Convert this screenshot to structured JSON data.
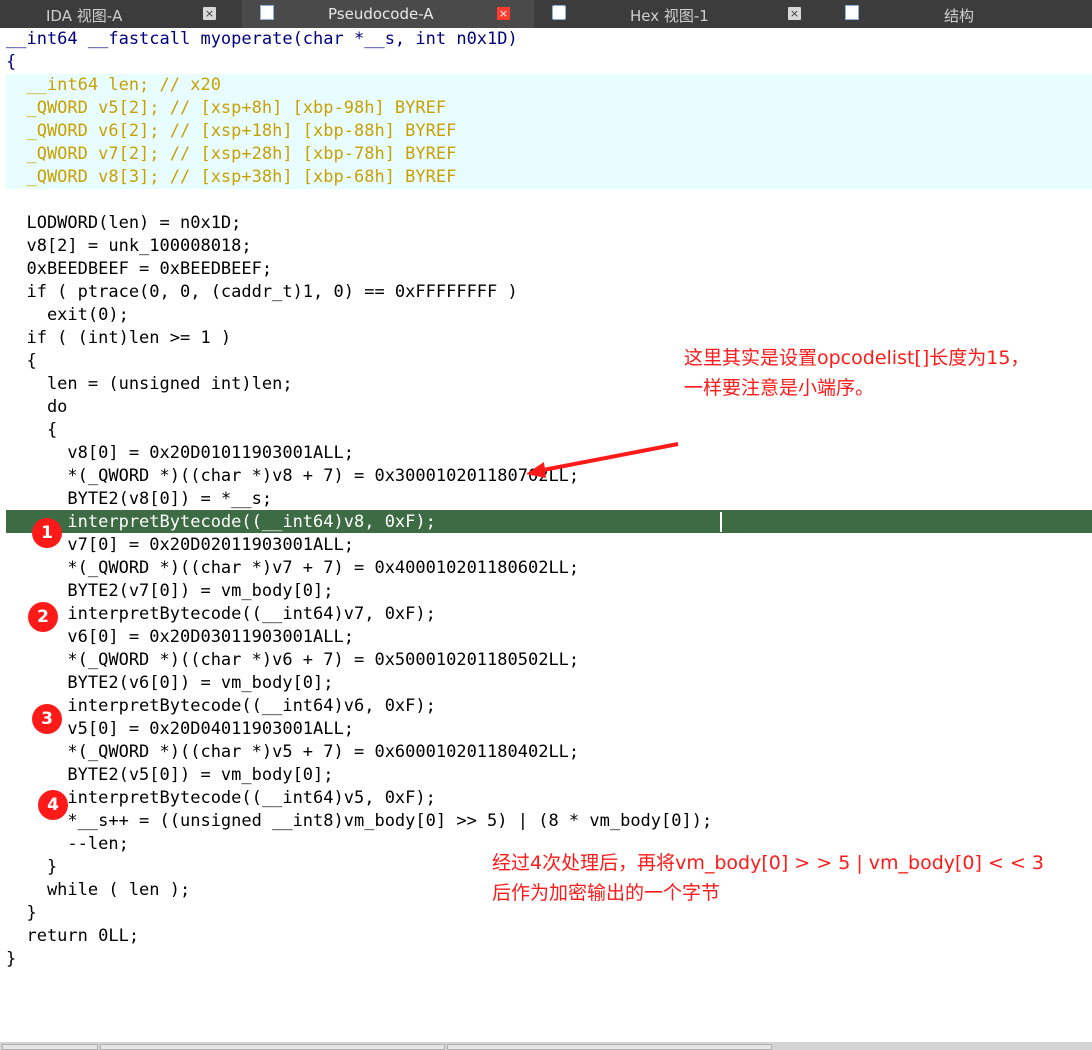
{
  "tabs": [
    {
      "label": "IDA 视图-A",
      "icon": "ida-view-icon",
      "active": false
    },
    {
      "label": "Pseudocode-A",
      "icon": "pseudocode-icon",
      "active": true
    },
    {
      "label": "Hex 视图-1",
      "icon": "hex-view-icon",
      "active": false
    },
    {
      "label": "结构",
      "icon": "structures-icon",
      "active": false
    }
  ],
  "close_glyph": "×",
  "code": {
    "signature": "__int64 __fastcall myoperate(char *__s, int n0x1D)",
    "brace_open": "{",
    "decls": [
      "  __int64 len; // x20",
      "  _QWORD v5[2]; // [xsp+8h] [xbp-98h] BYREF",
      "  _QWORD v6[2]; // [xsp+18h] [xbp-88h] BYREF",
      "  _QWORD v7[2]; // [xsp+28h] [xbp-78h] BYREF",
      "  _QWORD v8[3]; // [xsp+38h] [xbp-68h] BYREF"
    ],
    "body": [
      "",
      "  LODWORD(len) = n0x1D;",
      "  v8[2] = unk_100008018;",
      "  0xBEEDBEEF = 0xBEEDBEEF;",
      "  if ( ptrace(0, 0, (caddr_t)1, 0) == 0xFFFFFFFF )",
      "    exit(0);",
      "  if ( (int)len >= 1 )",
      "  {",
      "    len = (unsigned int)len;",
      "    do",
      "    {",
      "      v8[0] = 0x20D01011903001ALL;",
      "      *(_QWORD *)((char *)v8 + 7) = 0x300010201180702LL;",
      "      BYTE2(v8[0]) = *__s;",
      "      interpretBytecode((__int64)v8, 0xF);",
      "      v7[0] = 0x20D02011903001ALL;",
      "      *(_QWORD *)((char *)v7 + 7) = 0x400010201180602LL;",
      "      BYTE2(v7[0]) = vm_body[0];",
      "      interpretBytecode((__int64)v7, 0xF);",
      "      v6[0] = 0x20D03011903001ALL;",
      "      *(_QWORD *)((char *)v6 + 7) = 0x500010201180502LL;",
      "      BYTE2(v6[0]) = vm_body[0];",
      "      interpretBytecode((__int64)v6, 0xF);",
      "      v5[0] = 0x20D04011903001ALL;",
      "      *(_QWORD *)((char *)v5 + 7) = 0x600010201180402LL;",
      "      BYTE2(v5[0]) = vm_body[0];",
      "      interpretBytecode((__int64)v5, 0xF);",
      "      *__s++ = ((unsigned __int8)vm_body[0] >> 5) | (8 * vm_body[0]);",
      "      --len;",
      "    }",
      "    while ( len );",
      "  }",
      "  return 0LL;",
      "}"
    ]
  },
  "annotations": {
    "note1": "这里其实是设置opcodelist[]长度为15，\n一样要注意是小端序。",
    "note2": "经过4次处理后，再将vm_body[0] > > 5 | vm_body[0] < < 3\n后作为加密输出的一个字节",
    "markers": [
      "1",
      "2",
      "3",
      "4"
    ]
  },
  "colors": {
    "tabbar": "#3c3c3c",
    "highlight_line": "#3d6b43",
    "decl_background": "#e8fdff",
    "annotation_red": "#ff1a1a"
  }
}
